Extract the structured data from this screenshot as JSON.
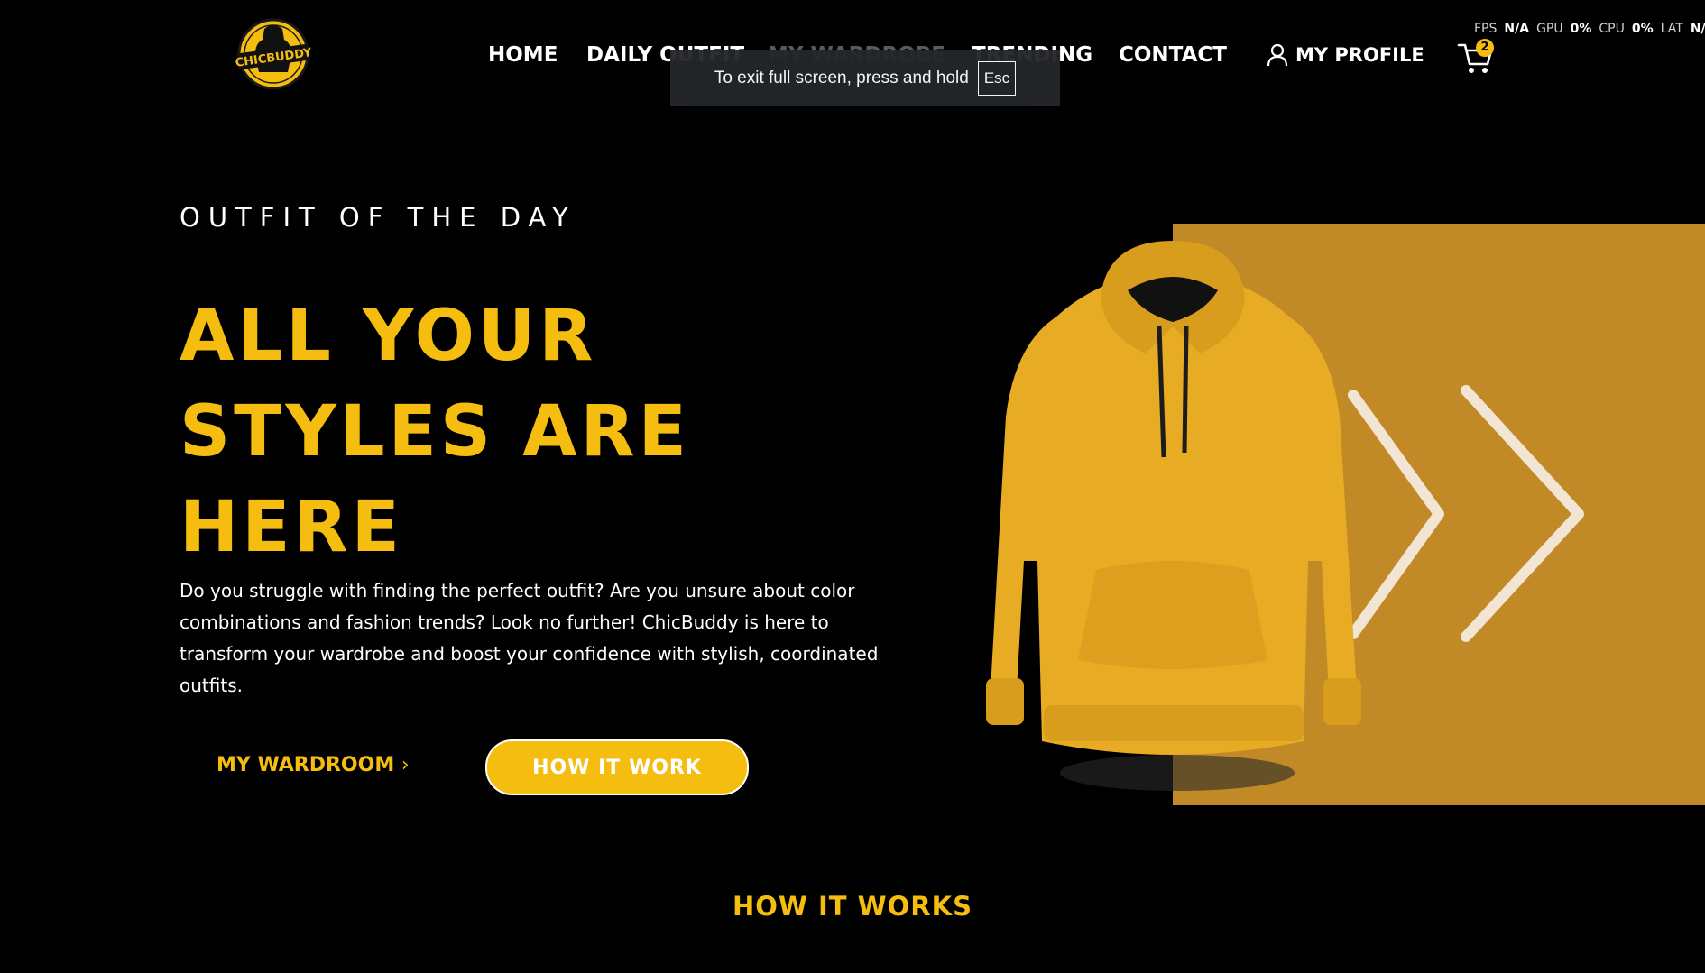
{
  "header": {
    "logo_text": "CHICBUDDY",
    "nav": [
      {
        "label": "HOME"
      },
      {
        "label": "DAILY OUTFIT"
      },
      {
        "label": "MY WARDROBE"
      },
      {
        "label": "TRENDING"
      },
      {
        "label": "CONTACT"
      }
    ],
    "profile_label": "MY PROFILE",
    "cart_count": "2"
  },
  "perf_overlay": {
    "fps_label": "FPS",
    "fps_value": "N/A",
    "gpu_label": "GPU",
    "gpu_value": "0%",
    "cpu_label": "CPU",
    "cpu_value": "0%",
    "lat_label": "LAT",
    "lat_value": "N/A"
  },
  "toast": {
    "text": "To exit full screen, press and hold",
    "key": "Esc"
  },
  "hero": {
    "eyebrow": "OUTFIT OF THE DAY",
    "headline_lines": [
      "ALL YOUR",
      "STYLES ARE",
      "HERE"
    ],
    "description": "Do you struggle with finding the perfect outfit? Are you unsure about color combinations and fashion trends? Look no further! ChicBuddy is here to transform your wardrobe and boost your confidence with stylish, coordinated outfits.",
    "secondary_button": "MY WARDROOM",
    "primary_button": "HOW IT WORK"
  },
  "section": {
    "title": "HOW IT WORKS"
  },
  "colors": {
    "accent": "#f5bd0f",
    "panel": "#c18a26",
    "background": "#000000"
  }
}
